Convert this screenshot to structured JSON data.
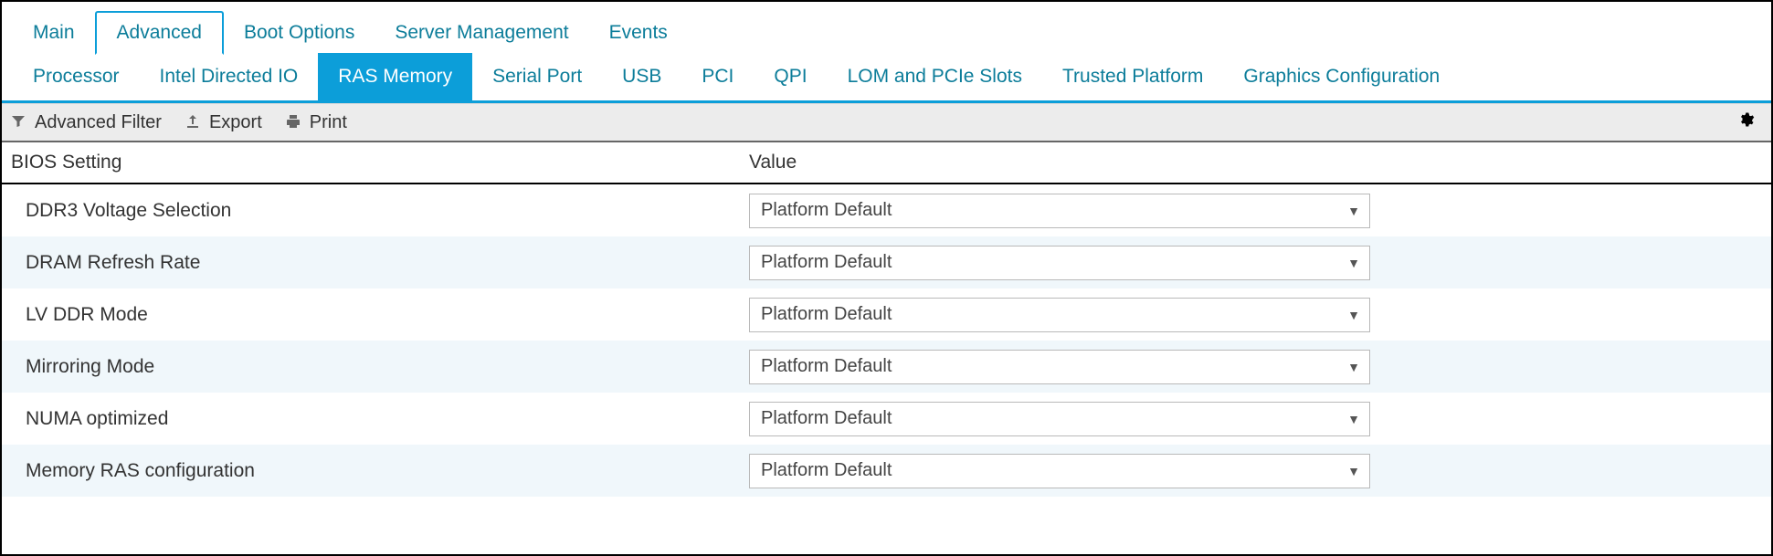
{
  "tabs1": [
    {
      "label": "Main",
      "active": false
    },
    {
      "label": "Advanced",
      "active": true
    },
    {
      "label": "Boot Options",
      "active": false
    },
    {
      "label": "Server Management",
      "active": false
    },
    {
      "label": "Events",
      "active": false
    }
  ],
  "tabs2": [
    {
      "label": "Processor",
      "active": false
    },
    {
      "label": "Intel Directed IO",
      "active": false
    },
    {
      "label": "RAS Memory",
      "active": true
    },
    {
      "label": "Serial Port",
      "active": false
    },
    {
      "label": "USB",
      "active": false
    },
    {
      "label": "PCI",
      "active": false
    },
    {
      "label": "QPI",
      "active": false
    },
    {
      "label": "LOM and PCIe Slots",
      "active": false
    },
    {
      "label": "Trusted Platform",
      "active": false
    },
    {
      "label": "Graphics Configuration",
      "active": false
    }
  ],
  "toolbar": {
    "advanced_filter": "Advanced Filter",
    "export": "Export",
    "print": "Print"
  },
  "table": {
    "header_setting": "BIOS Setting",
    "header_value": "Value"
  },
  "rows": [
    {
      "label": "DDR3 Voltage Selection",
      "value": "Platform Default"
    },
    {
      "label": "DRAM Refresh Rate",
      "value": "Platform Default"
    },
    {
      "label": "LV DDR Mode",
      "value": "Platform Default"
    },
    {
      "label": "Mirroring Mode",
      "value": "Platform Default"
    },
    {
      "label": "NUMA optimized",
      "value": "Platform Default"
    },
    {
      "label": "Memory RAS configuration",
      "value": "Platform Default"
    }
  ]
}
